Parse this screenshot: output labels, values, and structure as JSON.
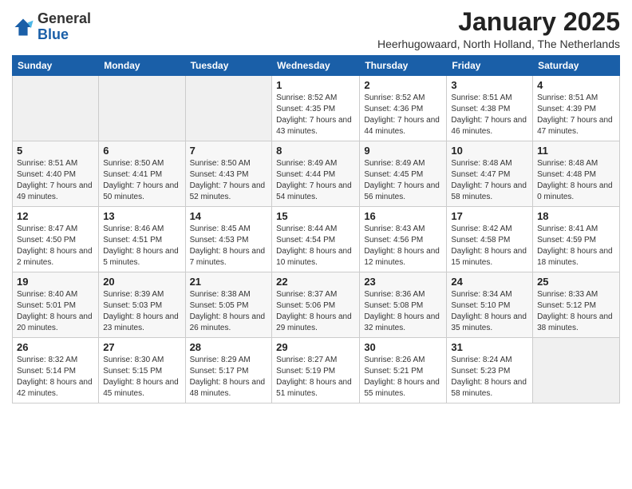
{
  "header": {
    "logo_general": "General",
    "logo_blue": "Blue",
    "month": "January 2025",
    "location": "Heerhugowaard, North Holland, The Netherlands"
  },
  "weekdays": [
    "Sunday",
    "Monday",
    "Tuesday",
    "Wednesday",
    "Thursday",
    "Friday",
    "Saturday"
  ],
  "weeks": [
    [
      {
        "day": "",
        "sunrise": "",
        "sunset": "",
        "daylight": ""
      },
      {
        "day": "",
        "sunrise": "",
        "sunset": "",
        "daylight": ""
      },
      {
        "day": "",
        "sunrise": "",
        "sunset": "",
        "daylight": ""
      },
      {
        "day": "1",
        "sunrise": "Sunrise: 8:52 AM",
        "sunset": "Sunset: 4:35 PM",
        "daylight": "Daylight: 7 hours and 43 minutes."
      },
      {
        "day": "2",
        "sunrise": "Sunrise: 8:52 AM",
        "sunset": "Sunset: 4:36 PM",
        "daylight": "Daylight: 7 hours and 44 minutes."
      },
      {
        "day": "3",
        "sunrise": "Sunrise: 8:51 AM",
        "sunset": "Sunset: 4:38 PM",
        "daylight": "Daylight: 7 hours and 46 minutes."
      },
      {
        "day": "4",
        "sunrise": "Sunrise: 8:51 AM",
        "sunset": "Sunset: 4:39 PM",
        "daylight": "Daylight: 7 hours and 47 minutes."
      }
    ],
    [
      {
        "day": "5",
        "sunrise": "Sunrise: 8:51 AM",
        "sunset": "Sunset: 4:40 PM",
        "daylight": "Daylight: 7 hours and 49 minutes."
      },
      {
        "day": "6",
        "sunrise": "Sunrise: 8:50 AM",
        "sunset": "Sunset: 4:41 PM",
        "daylight": "Daylight: 7 hours and 50 minutes."
      },
      {
        "day": "7",
        "sunrise": "Sunrise: 8:50 AM",
        "sunset": "Sunset: 4:43 PM",
        "daylight": "Daylight: 7 hours and 52 minutes."
      },
      {
        "day": "8",
        "sunrise": "Sunrise: 8:49 AM",
        "sunset": "Sunset: 4:44 PM",
        "daylight": "Daylight: 7 hours and 54 minutes."
      },
      {
        "day": "9",
        "sunrise": "Sunrise: 8:49 AM",
        "sunset": "Sunset: 4:45 PM",
        "daylight": "Daylight: 7 hours and 56 minutes."
      },
      {
        "day": "10",
        "sunrise": "Sunrise: 8:48 AM",
        "sunset": "Sunset: 4:47 PM",
        "daylight": "Daylight: 7 hours and 58 minutes."
      },
      {
        "day": "11",
        "sunrise": "Sunrise: 8:48 AM",
        "sunset": "Sunset: 4:48 PM",
        "daylight": "Daylight: 8 hours and 0 minutes."
      }
    ],
    [
      {
        "day": "12",
        "sunrise": "Sunrise: 8:47 AM",
        "sunset": "Sunset: 4:50 PM",
        "daylight": "Daylight: 8 hours and 2 minutes."
      },
      {
        "day": "13",
        "sunrise": "Sunrise: 8:46 AM",
        "sunset": "Sunset: 4:51 PM",
        "daylight": "Daylight: 8 hours and 5 minutes."
      },
      {
        "day": "14",
        "sunrise": "Sunrise: 8:45 AM",
        "sunset": "Sunset: 4:53 PM",
        "daylight": "Daylight: 8 hours and 7 minutes."
      },
      {
        "day": "15",
        "sunrise": "Sunrise: 8:44 AM",
        "sunset": "Sunset: 4:54 PM",
        "daylight": "Daylight: 8 hours and 10 minutes."
      },
      {
        "day": "16",
        "sunrise": "Sunrise: 8:43 AM",
        "sunset": "Sunset: 4:56 PM",
        "daylight": "Daylight: 8 hours and 12 minutes."
      },
      {
        "day": "17",
        "sunrise": "Sunrise: 8:42 AM",
        "sunset": "Sunset: 4:58 PM",
        "daylight": "Daylight: 8 hours and 15 minutes."
      },
      {
        "day": "18",
        "sunrise": "Sunrise: 8:41 AM",
        "sunset": "Sunset: 4:59 PM",
        "daylight": "Daylight: 8 hours and 18 minutes."
      }
    ],
    [
      {
        "day": "19",
        "sunrise": "Sunrise: 8:40 AM",
        "sunset": "Sunset: 5:01 PM",
        "daylight": "Daylight: 8 hours and 20 minutes."
      },
      {
        "day": "20",
        "sunrise": "Sunrise: 8:39 AM",
        "sunset": "Sunset: 5:03 PM",
        "daylight": "Daylight: 8 hours and 23 minutes."
      },
      {
        "day": "21",
        "sunrise": "Sunrise: 8:38 AM",
        "sunset": "Sunset: 5:05 PM",
        "daylight": "Daylight: 8 hours and 26 minutes."
      },
      {
        "day": "22",
        "sunrise": "Sunrise: 8:37 AM",
        "sunset": "Sunset: 5:06 PM",
        "daylight": "Daylight: 8 hours and 29 minutes."
      },
      {
        "day": "23",
        "sunrise": "Sunrise: 8:36 AM",
        "sunset": "Sunset: 5:08 PM",
        "daylight": "Daylight: 8 hours and 32 minutes."
      },
      {
        "day": "24",
        "sunrise": "Sunrise: 8:34 AM",
        "sunset": "Sunset: 5:10 PM",
        "daylight": "Daylight: 8 hours and 35 minutes."
      },
      {
        "day": "25",
        "sunrise": "Sunrise: 8:33 AM",
        "sunset": "Sunset: 5:12 PM",
        "daylight": "Daylight: 8 hours and 38 minutes."
      }
    ],
    [
      {
        "day": "26",
        "sunrise": "Sunrise: 8:32 AM",
        "sunset": "Sunset: 5:14 PM",
        "daylight": "Daylight: 8 hours and 42 minutes."
      },
      {
        "day": "27",
        "sunrise": "Sunrise: 8:30 AM",
        "sunset": "Sunset: 5:15 PM",
        "daylight": "Daylight: 8 hours and 45 minutes."
      },
      {
        "day": "28",
        "sunrise": "Sunrise: 8:29 AM",
        "sunset": "Sunset: 5:17 PM",
        "daylight": "Daylight: 8 hours and 48 minutes."
      },
      {
        "day": "29",
        "sunrise": "Sunrise: 8:27 AM",
        "sunset": "Sunset: 5:19 PM",
        "daylight": "Daylight: 8 hours and 51 minutes."
      },
      {
        "day": "30",
        "sunrise": "Sunrise: 8:26 AM",
        "sunset": "Sunset: 5:21 PM",
        "daylight": "Daylight: 8 hours and 55 minutes."
      },
      {
        "day": "31",
        "sunrise": "Sunrise: 8:24 AM",
        "sunset": "Sunset: 5:23 PM",
        "daylight": "Daylight: 8 hours and 58 minutes."
      },
      {
        "day": "",
        "sunrise": "",
        "sunset": "",
        "daylight": ""
      }
    ]
  ]
}
